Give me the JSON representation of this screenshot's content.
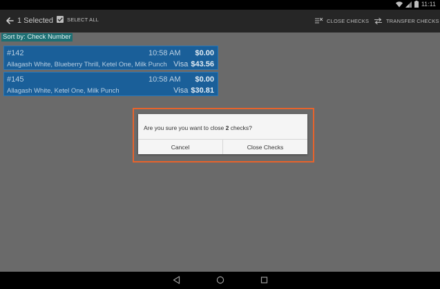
{
  "status": {
    "time": "11:11"
  },
  "toolbar": {
    "selected_text": "1 Selected",
    "select_all_label": "SELECT ALL",
    "close_checks_label": "CLOSE CHECKS",
    "transfer_checks_label": "TRANSFER CHECKS"
  },
  "sort": {
    "label": "Sort by: Check Number"
  },
  "checks": [
    {
      "number": "#142",
      "time": "10:58 AM",
      "amount_due": "$0.00",
      "items": "Allagash White, Blueberry Thrill, Ketel One, Milk Punch",
      "payment_method": "Visa",
      "payment_amount": "$43.56"
    },
    {
      "number": "#145",
      "time": "10:58 AM",
      "amount_due": "$0.00",
      "items": "Allagash White, Ketel One, Milk Punch",
      "payment_method": "Visa",
      "payment_amount": "$30.81"
    }
  ],
  "dialog": {
    "message_prefix": "Are you sure you want to close ",
    "message_count": "2",
    "message_suffix": " checks?",
    "cancel_label": "Cancel",
    "confirm_label": "Close Checks"
  },
  "colors": {
    "toolbar_bg": "#262626",
    "card_bg": "#1a5f99",
    "sort_label_bg": "#1d6f73",
    "highlight": "#e8632b",
    "backdrop": "#6a6a6a"
  }
}
